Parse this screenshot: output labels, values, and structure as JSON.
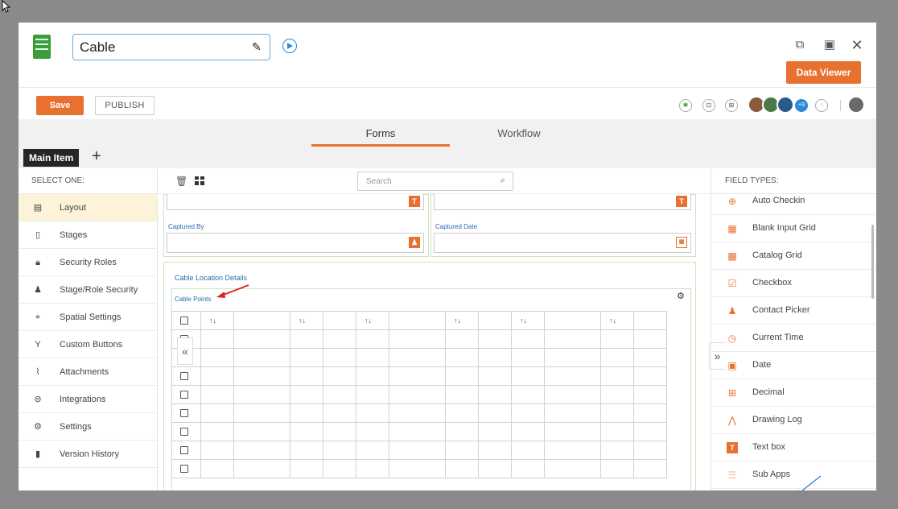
{
  "header": {
    "title": "Cable",
    "data_viewer": "Data Viewer"
  },
  "toolbar": {
    "save": "Save",
    "publish": "PUBLISH",
    "avatar_more": "+9"
  },
  "tabs": [
    {
      "label": "Forms",
      "active": true
    },
    {
      "label": "Workflow",
      "active": false
    }
  ],
  "main_item": "Main Item",
  "left_panel": {
    "header": "SELECT ONE:",
    "items": [
      {
        "label": "Layout",
        "icon": "layout-icon",
        "selected": true
      },
      {
        "label": "Stages",
        "icon": "document-icon"
      },
      {
        "label": "Security Roles",
        "icon": "lock-icon"
      },
      {
        "label": "Stage/Role Security",
        "icon": "user-lock-icon"
      },
      {
        "label": "Spatial Settings",
        "icon": "spatial-icon"
      },
      {
        "label": "Custom Buttons",
        "icon": "fork-icon"
      },
      {
        "label": "Attachments",
        "icon": "paperclip-icon"
      },
      {
        "label": "Integrations",
        "icon": "integration-icon"
      },
      {
        "label": "Settings",
        "icon": "gears-icon"
      },
      {
        "label": "Version History",
        "icon": "version-icon"
      }
    ]
  },
  "center": {
    "search_placeholder": "Search",
    "captured_by": "Captured By",
    "captured_date": "Captured Date",
    "section_title": "Cable Location Details",
    "grid_title": "Cable Points",
    "sort_glyph": "↑↓",
    "rows": 8
  },
  "right_panel": {
    "header": "FIELD TYPES:",
    "items": [
      {
        "label": "Auto Checkin",
        "icon": "crosshair-icon"
      },
      {
        "label": "Blank Input Grid",
        "icon": "grid-icon"
      },
      {
        "label": "Catalog Grid",
        "icon": "catalog-icon"
      },
      {
        "label": "Checkbox",
        "icon": "checkbox-icon"
      },
      {
        "label": "Contact Picker",
        "icon": "contact-icon"
      },
      {
        "label": "Current Time",
        "icon": "clock-icon"
      },
      {
        "label": "Date",
        "icon": "calendar-icon"
      },
      {
        "label": "Decimal",
        "icon": "decimal-icon"
      },
      {
        "label": "Drawing Log",
        "icon": "compass-icon"
      },
      {
        "label": "Text box",
        "icon": "textbox-icon"
      },
      {
        "label": "Sub Apps",
        "icon": "subapps-icon"
      }
    ]
  },
  "colors": {
    "accent": "#e9712f",
    "link": "#2a6aa8",
    "selected_bg": "#fdf3d8"
  }
}
